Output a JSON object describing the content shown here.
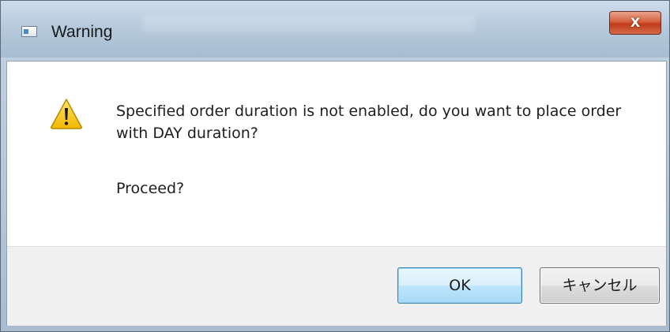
{
  "window": {
    "title": "Warning",
    "close_glyph": "X"
  },
  "dialog": {
    "icon": "warning-icon",
    "message": "Specified order duration is not enabled, do you want to place order with DAY duration?",
    "prompt": "Proceed?"
  },
  "buttons": {
    "ok_label": "OK",
    "cancel_label": "キャンセル"
  },
  "colors": {
    "close_button": "#c8452a",
    "ok_border": "#3c7fb1",
    "warning_fill": "#f5c400"
  }
}
